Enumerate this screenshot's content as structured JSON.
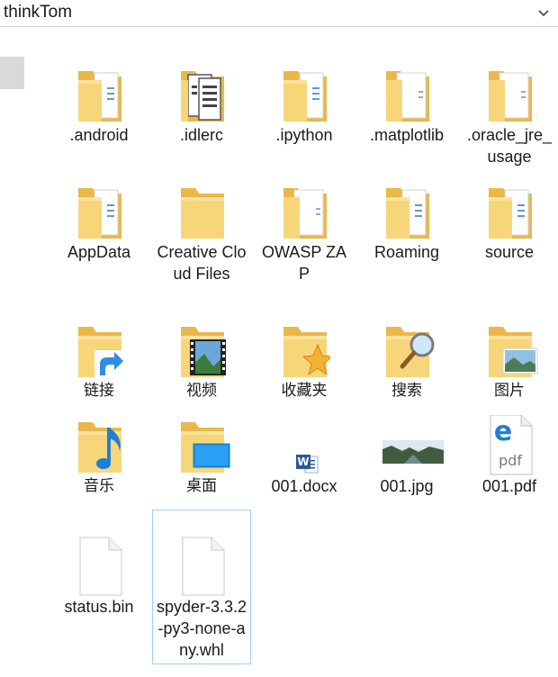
{
  "address_bar": {
    "path": "thinkTom"
  },
  "items": [
    {
      "name": ".android",
      "kind": "folder-docs",
      "icon": "folder-icon"
    },
    {
      "name": ".idlerc",
      "kind": "folder-files",
      "icon": "folder-icon"
    },
    {
      "name": ".ipython",
      "kind": "folder-docs",
      "icon": "folder-icon"
    },
    {
      "name": ".matplotlib",
      "kind": "folder-paper",
      "icon": "folder-icon"
    },
    {
      "name": ".oracle_jre_usage",
      "kind": "folder-paper",
      "icon": "folder-icon"
    },
    {
      "name": "AppData",
      "kind": "folder-docs",
      "icon": "folder-icon"
    },
    {
      "name": "Creative Cloud Files",
      "kind": "folder-plain",
      "icon": "folder-icon"
    },
    {
      "name": "OWASP ZAP",
      "kind": "folder-paper",
      "icon": "folder-icon"
    },
    {
      "name": "Roaming",
      "kind": "folder-docs",
      "icon": "folder-icon"
    },
    {
      "name": "source",
      "kind": "folder-docs",
      "icon": "folder-icon"
    },
    {
      "name": "链接",
      "kind": "links",
      "icon": "links-folder-icon"
    },
    {
      "name": "视频",
      "kind": "videos",
      "icon": "videos-folder-icon"
    },
    {
      "name": "收藏夹",
      "kind": "favorites",
      "icon": "favorites-folder-icon"
    },
    {
      "name": "搜索",
      "kind": "searches",
      "icon": "searches-folder-icon"
    },
    {
      "name": "图片",
      "kind": "pictures",
      "icon": "pictures-folder-icon"
    },
    {
      "name": "音乐",
      "kind": "music",
      "icon": "music-folder-icon"
    },
    {
      "name": "桌面",
      "kind": "desktop",
      "icon": "desktop-folder-icon"
    },
    {
      "name": "001.docx",
      "kind": "docx",
      "icon": "word-document-icon"
    },
    {
      "name": "001.jpg",
      "kind": "jpg",
      "icon": "image-thumbnail-icon"
    },
    {
      "name": "001.pdf",
      "kind": "pdf",
      "icon": "pdf-document-icon",
      "badge": "pdf"
    },
    {
      "name": "status.bin",
      "kind": "file",
      "icon": "blank-file-icon"
    },
    {
      "name": "spyder-3.3.2-py3-none-any.whl",
      "kind": "file",
      "icon": "blank-file-icon",
      "selected": true
    }
  ],
  "colors": {
    "folder": "#f7d679",
    "folder_back": "#e9b849",
    "selection_border": "#99d1ff",
    "text": "#1a1a1a"
  }
}
